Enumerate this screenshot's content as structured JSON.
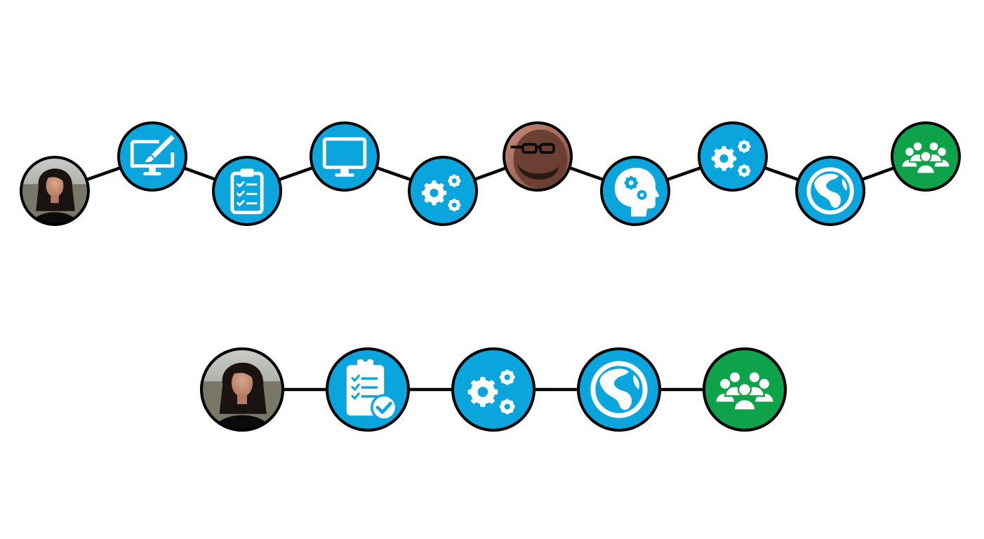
{
  "colors": {
    "node_blue": "#0aa5dc",
    "node_green": "#0ea34a",
    "stroke": "#000000",
    "icon": "#ffffff"
  },
  "rows": [
    {
      "layout": "zigzag",
      "nodes": [
        {
          "kind": "photo",
          "icon": "woman-avatar-photo"
        },
        {
          "kind": "icon",
          "icon": "monitor-paintbrush-icon",
          "color": "blue"
        },
        {
          "kind": "icon",
          "icon": "clipboard-checklist-icon",
          "color": "blue"
        },
        {
          "kind": "icon",
          "icon": "monitor-icon",
          "color": "blue"
        },
        {
          "kind": "icon",
          "icon": "gears-icon",
          "color": "blue"
        },
        {
          "kind": "photo",
          "icon": "man-avatar-photo"
        },
        {
          "kind": "icon",
          "icon": "head-gears-icon",
          "color": "blue"
        },
        {
          "kind": "icon",
          "icon": "gears-icon",
          "color": "blue"
        },
        {
          "kind": "icon",
          "icon": "globe-icon",
          "color": "blue"
        },
        {
          "kind": "icon",
          "icon": "team-group-icon",
          "color": "green"
        }
      ]
    },
    {
      "layout": "straight",
      "nodes": [
        {
          "kind": "photo",
          "icon": "woman-avatar-photo"
        },
        {
          "kind": "icon",
          "icon": "clipboard-approved-icon",
          "color": "blue"
        },
        {
          "kind": "icon",
          "icon": "gears-icon",
          "color": "blue"
        },
        {
          "kind": "icon",
          "icon": "globe-icon",
          "color": "blue"
        },
        {
          "kind": "icon",
          "icon": "team-group-icon",
          "color": "green"
        }
      ]
    }
  ]
}
